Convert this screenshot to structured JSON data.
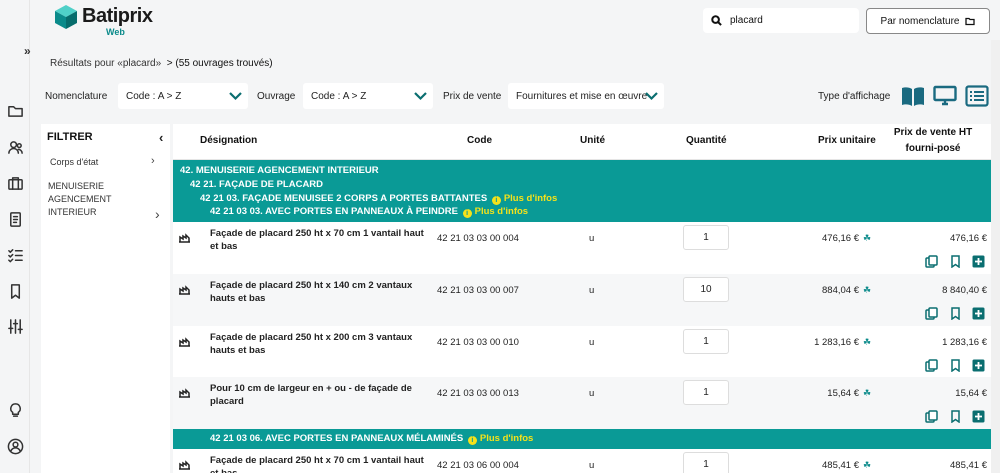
{
  "app": {
    "name": "Batiprix",
    "sub": "Web"
  },
  "sidebar": {
    "icons": [
      "collapse-icon",
      "folder-icon",
      "users-icon",
      "briefcase-icon",
      "document-icon",
      "checklist-icon",
      "bookmark-icon",
      "sliders-icon",
      "lightbulb-icon",
      "user-icon"
    ]
  },
  "search": {
    "value": "placard"
  },
  "nomenclature_button": {
    "label": "Par nomenclature"
  },
  "results": {
    "prefix": "Résultats pour «placard»",
    "suffix": "> (55 ouvrages trouvés)"
  },
  "toolbar": {
    "nomenclature_label": "Nomenclature",
    "nomenclature_value": "Code : A > Z",
    "ouvrage_label": "Ouvrage",
    "ouvrage_value": "Code : A > Z",
    "prix_label": "Prix de vente",
    "prix_value": "Fournitures et mise en œuvre",
    "display_label": "Type d'affichage"
  },
  "filter": {
    "title": "FILTRER",
    "items": [
      {
        "label": "Corps d'état"
      },
      {
        "label": "MENUISERIE AGENCEMENT INTERIEUR"
      }
    ]
  },
  "table": {
    "headers": {
      "designation": "Désignation",
      "code": "Code",
      "unite": "Unité",
      "quantite": "Quantité",
      "prix_unitaire": "Prix unitaire",
      "prix_vente": "Prix de vente HT fourni-posé"
    },
    "group1": {
      "l1": "42. MENUISERIE AGENCEMENT INTERIEUR",
      "l2": "42 21. FAÇADE DE PLACARD",
      "l3": "42 21 03. FAÇADE MENUISEE 2 CORPS A PORTES BATTANTES",
      "l4": "42 21 03 03. AVEC PORTES EN PANNEAUX À PEINDRE",
      "info": "Plus d'infos"
    },
    "rows": [
      {
        "designation": "Façade de placard 250 ht x 70 cm 1 vantail haut et bas",
        "code": "42 21 03 03 00 004",
        "unit": "u",
        "qty": "1",
        "pu": "476,16 €",
        "pv": "476,16 €"
      },
      {
        "designation": "Façade de placard 250 ht x 140 cm 2 vantaux hauts et bas",
        "code": "42 21 03 03 00 007",
        "unit": "u",
        "qty": "10",
        "pu": "884,04 €",
        "pv": "8 840,40 €"
      },
      {
        "designation": "Façade de placard 250 ht x 200 cm 3 vantaux hauts et bas",
        "code": "42 21 03 03 00 010",
        "unit": "u",
        "qty": "1",
        "pu": "1 283,16 €",
        "pv": "1 283,16 €"
      },
      {
        "designation": "Pour 10 cm de largeur en + ou - de façade de placard",
        "code": "42 21 03 03 00 013",
        "unit": "u",
        "qty": "1",
        "pu": "15,64 €",
        "pv": "15,64 €"
      }
    ],
    "group2": {
      "l1": "42 21 03 06. AVEC PORTES EN PANNEAUX MÉLAMINÉS",
      "info": "Plus d'infos"
    },
    "row5": {
      "designation": "Façade de placard 250 ht x 70 cm 1 vantail haut et bas",
      "code": "42 21 03 06 00 004",
      "unit": "u",
      "qty": "1",
      "pu": "485,41 €",
      "pv": "485,41 €"
    }
  },
  "colors": {
    "teal": "#0a9a96",
    "accent_dark": "#0a6e70",
    "info_yellow": "#f5e21a"
  }
}
